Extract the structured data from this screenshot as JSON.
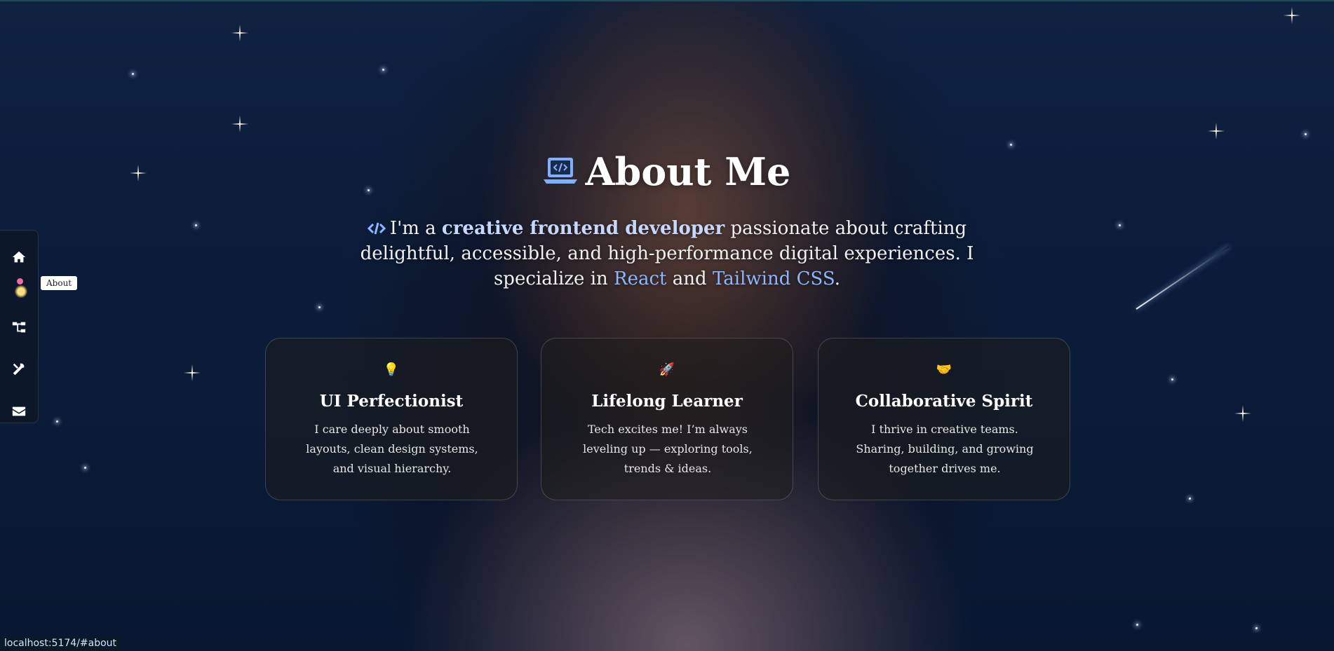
{
  "nav": {
    "items": [
      {
        "name": "home",
        "icon": "home-icon"
      },
      {
        "name": "about",
        "icon": "person-icon"
      },
      {
        "name": "projects",
        "icon": "sitemap-icon"
      },
      {
        "name": "skills",
        "icon": "tools-icon"
      },
      {
        "name": "contact",
        "icon": "envelope-icon"
      }
    ],
    "tooltip": "About"
  },
  "about": {
    "title": "About Me",
    "title_icon": "laptop-code-icon",
    "intro": {
      "prefix": "I'm a ",
      "highlight": "creative frontend developer",
      "middle": " passionate about crafting delightful, accessible, and high-performance digital experiences. I specialize in ",
      "tech1": "React",
      "joiner": " and ",
      "tech2": "Tailwind CSS",
      "suffix": "."
    },
    "cards": [
      {
        "emoji": "💡",
        "title": "UI Perfectionist",
        "text": "I care deeply about smooth layouts, clean design systems, and visual hierarchy."
      },
      {
        "emoji": "🚀",
        "title": "Lifelong Learner",
        "text": "Tech excites me! I’m always leveling up — exploring tools, trends & ideas."
      },
      {
        "emoji": "🤝",
        "title": "Collaborative Spirit",
        "text": "I thrive in creative teams. Sharing, building, and growing together drives me."
      }
    ]
  },
  "status_url": "localhost:5174/#about",
  "colors": {
    "accent": "#8db6ff",
    "highlight": "#c7d8ff",
    "icon_blue": "#7fb0ff"
  }
}
